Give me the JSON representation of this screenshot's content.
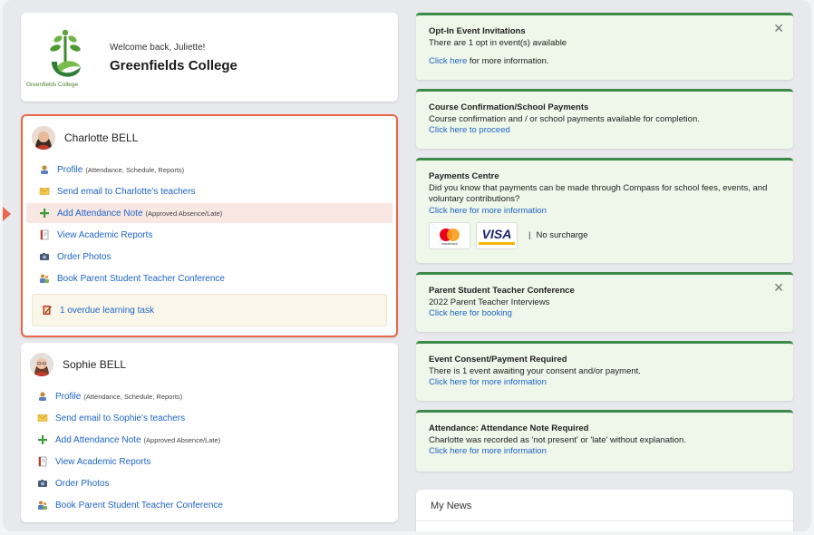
{
  "header": {
    "welcome": "Welcome back, Juliette!",
    "school_name": "Greenfields College",
    "logo_caption": "Greenfields College"
  },
  "students": [
    {
      "name": "Charlotte BELL",
      "links": [
        {
          "label": "Profile",
          "aside": "(Attendance, Schedule, Reports)",
          "icon": "profile-icon"
        },
        {
          "label": "Send email to Charlotte's teachers",
          "aside": "",
          "icon": "envelope-icon"
        },
        {
          "label": "Add Attendance Note",
          "aside": "(Approved Absence/Late)",
          "icon": "plus-icon"
        },
        {
          "label": "View Academic Reports",
          "aside": "",
          "icon": "report-icon"
        },
        {
          "label": "Order Photos",
          "aside": "",
          "icon": "camera-icon"
        },
        {
          "label": "Book Parent Student Teacher Conference",
          "aside": "",
          "icon": "conference-icon"
        }
      ],
      "overdue": "1 overdue learning task"
    },
    {
      "name": "Sophie BELL",
      "links": [
        {
          "label": "Profile",
          "aside": "(Attendance, Schedule, Reports)",
          "icon": "profile-icon"
        },
        {
          "label": "Send email to Sophie's teachers",
          "aside": "",
          "icon": "envelope-icon"
        },
        {
          "label": "Add Attendance Note",
          "aside": "(Approved Absence/Late)",
          "icon": "plus-icon"
        },
        {
          "label": "View Academic Reports",
          "aside": "",
          "icon": "report-icon"
        },
        {
          "label": "Order Photos",
          "aside": "",
          "icon": "camera-icon"
        },
        {
          "label": "Book Parent Student Teacher Conference",
          "aside": "",
          "icon": "conference-icon"
        }
      ]
    }
  ],
  "notices": [
    {
      "title": "Opt-In Event Invitations",
      "body": "There are 1 opt in event(s) available",
      "link": "Click here",
      "link_suffix": " for more information."
    },
    {
      "title": "Course Confirmation/School Payments",
      "body": "Course confirmation and / or school payments available for completion.",
      "link": "Click here to proceed"
    },
    {
      "title": "Payments Centre",
      "body": "Did you know that payments can be made through Compass for school fees, events, and voluntary contributions?",
      "link": "Click here for more information",
      "card_brands": [
        "mastercard",
        "VISA"
      ],
      "surcharge": "No surcharge",
      "sep": "|"
    },
    {
      "title": "Parent Student Teacher Conference",
      "body": "2022 Parent Teacher Interviews",
      "link": "Click here for booking"
    },
    {
      "title": "Event Consent/Payment Required",
      "body": "There is 1 event awaiting your consent and/or payment.",
      "link": "Click here for more information"
    },
    {
      "title": "Attendance: Attendance Note Required",
      "body": "Charlotte was recorded as 'not present' or 'late' without explanation.",
      "link": "Click here for more information"
    }
  ],
  "close_glyph": "✕",
  "news": {
    "title": "My News"
  },
  "colors": {
    "accent_link": "#1f63c6",
    "active_border": "#e8674a",
    "notice_bg": "#eef7ea",
    "notice_border": "#3b8a4a"
  }
}
